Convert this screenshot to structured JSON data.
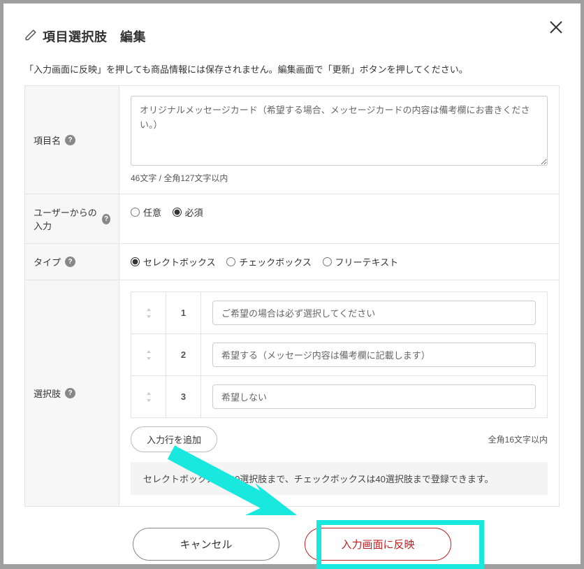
{
  "header": {
    "title": "項目選択肢　編集"
  },
  "notice": "「入力画面に反映」を押しても商品情報には保存されません。編集画面で「更新」ボタンを押してください。",
  "form": {
    "item_name": {
      "label": "項目名",
      "value": "オリジナルメッセージカード（希望する場合、メッセージカードの内容は備考欄にお書きください。）",
      "counter": "46文字 / 全角127文字以内"
    },
    "user_input": {
      "label": "ユーザーからの入力",
      "options": [
        {
          "label": "任意",
          "checked": false
        },
        {
          "label": "必須",
          "checked": true
        }
      ]
    },
    "type": {
      "label": "タイプ",
      "options": [
        {
          "label": "セレクトボックス",
          "checked": true
        },
        {
          "label": "チェックボックス",
          "checked": false
        },
        {
          "label": "フリーテキスト",
          "checked": false
        }
      ]
    },
    "choices": {
      "label": "選択肢",
      "rows": [
        {
          "num": "1",
          "value": "ご希望の場合は必ず選択してください"
        },
        {
          "num": "2",
          "value": "希望する（メッセージ内容は備考欄に記載します）"
        },
        {
          "num": "3",
          "value": "希望しない"
        }
      ],
      "add_label": "入力行を追加",
      "limit_text": "全角16文字以内",
      "hint": "セレクトボックスは100選択肢まで、チェックボックスは40選択肢まで登録できます。"
    }
  },
  "footer": {
    "cancel": "キャンセル",
    "apply": "入力画面に反映"
  }
}
